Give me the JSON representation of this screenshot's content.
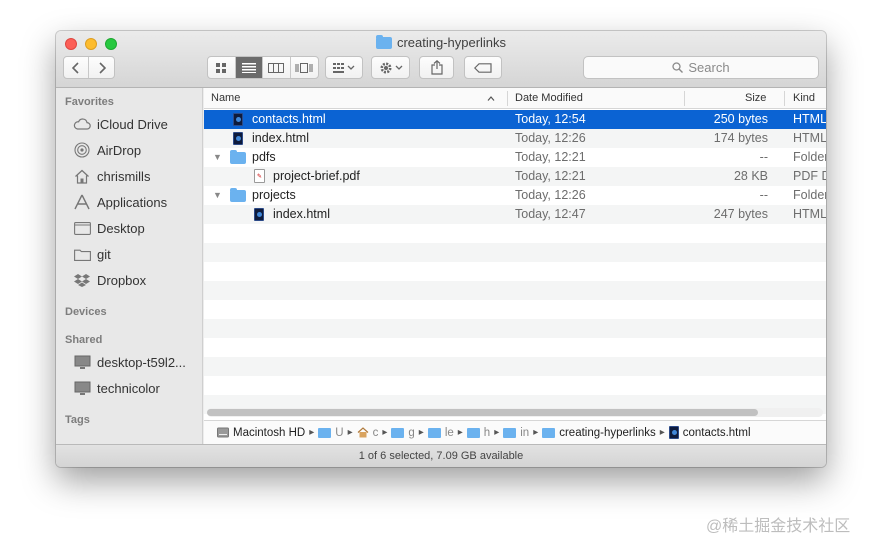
{
  "window": {
    "title": "creating-hyperlinks"
  },
  "toolbar": {
    "back_icon": "chevron-left-icon",
    "forward_icon": "chevron-right-icon",
    "view_modes": [
      "icon-view",
      "list-view",
      "column-view",
      "cover-flow-view"
    ],
    "active_view": "list-view",
    "search_placeholder": "Search"
  },
  "sidebar": {
    "favorites_heading": "Favorites",
    "favorites": [
      {
        "label": "iCloud Drive",
        "icon": "cloud-icon"
      },
      {
        "label": "AirDrop",
        "icon": "airdrop-icon"
      },
      {
        "label": "chrismills",
        "icon": "home-icon"
      },
      {
        "label": "Applications",
        "icon": "applications-icon"
      },
      {
        "label": "Desktop",
        "icon": "desktop-folder-icon"
      },
      {
        "label": "git",
        "icon": "folder-icon"
      },
      {
        "label": "Dropbox",
        "icon": "dropbox-icon"
      }
    ],
    "devices_heading": "Devices",
    "shared_heading": "Shared",
    "shared": [
      {
        "label": "desktop-t59l2...",
        "icon": "computer-icon"
      },
      {
        "label": "technicolor",
        "icon": "computer-icon"
      }
    ],
    "tags_heading": "Tags"
  },
  "columns": {
    "name": "Name",
    "date": "Date Modified",
    "size": "Size",
    "kind": "Kind"
  },
  "rows": [
    {
      "name": "contacts.html",
      "date": "Today, 12:54",
      "size": "250 bytes",
      "kind": "HTML",
      "type": "html",
      "indent": 0,
      "selected": true
    },
    {
      "name": "index.html",
      "date": "Today, 12:26",
      "size": "174 bytes",
      "kind": "HTML",
      "type": "html",
      "indent": 0
    },
    {
      "name": "pdfs",
      "date": "Today, 12:21",
      "size": "--",
      "kind": "Folder",
      "type": "folder",
      "indent": 0,
      "expanded": true
    },
    {
      "name": "project-brief.pdf",
      "date": "Today, 12:21",
      "size": "28 KB",
      "kind": "PDF D",
      "type": "pdf",
      "indent": 1
    },
    {
      "name": "projects",
      "date": "Today, 12:26",
      "size": "--",
      "kind": "Folder",
      "type": "folder",
      "indent": 0,
      "expanded": true
    },
    {
      "name": "index.html",
      "date": "Today, 12:47",
      "size": "247 bytes",
      "kind": "HTML",
      "type": "html",
      "indent": 1
    }
  ],
  "empty_rows": 10,
  "pathbar": [
    {
      "label": "Macintosh HD",
      "icon": "disk-icon"
    },
    {
      "label": "U",
      "icon": "folder-icon",
      "short": true
    },
    {
      "label": "c",
      "icon": "home-icon",
      "short": true
    },
    {
      "label": "g",
      "icon": "folder-icon",
      "short": true
    },
    {
      "label": "le",
      "icon": "folder-icon",
      "short": true
    },
    {
      "label": "h",
      "icon": "folder-icon",
      "short": true
    },
    {
      "label": "in",
      "icon": "folder-icon",
      "short": true
    },
    {
      "label": "creating-hyperlinks",
      "icon": "folder-icon"
    },
    {
      "label": "contacts.html",
      "icon": "html-file-icon"
    }
  ],
  "status": "1 of 6 selected, 7.09 GB available",
  "watermark": "@稀土掘金技术社区",
  "colors": {
    "selection": "#0b63d3",
    "folder": "#6bb2ef"
  }
}
